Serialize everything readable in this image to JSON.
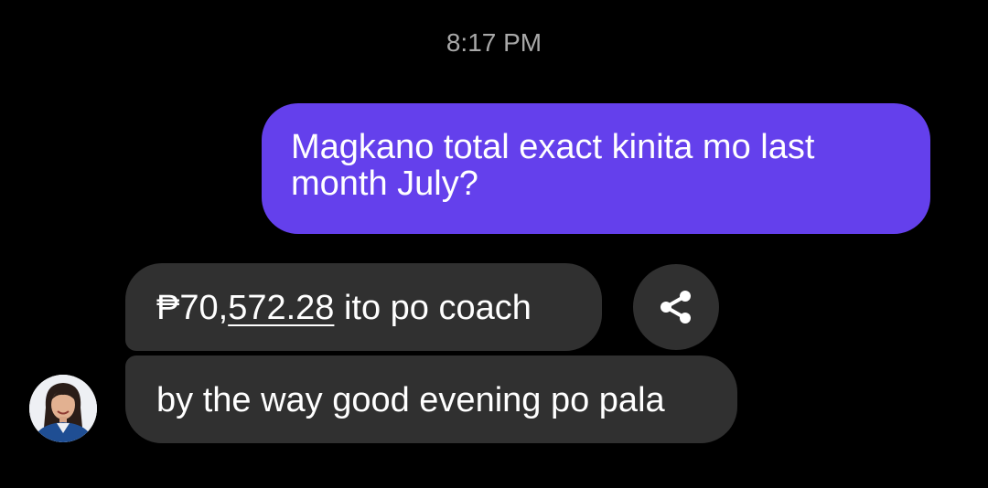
{
  "chat": {
    "timestamp": "8:17 PM",
    "messages": [
      {
        "direction": "outgoing",
        "text": "Magkano total exact kinita mo last month July?"
      },
      {
        "direction": "incoming",
        "currency_symbol": "₱",
        "amount_prefix": "70,",
        "amount_link": "572.28",
        "text_suffix": " ito po coach"
      },
      {
        "direction": "incoming",
        "text": "by the way good evening po pala"
      }
    ],
    "share_icon": "share-icon",
    "avatar_icon": "contact-avatar"
  },
  "colors": {
    "background": "#000000",
    "outgoing_bubble": "#6440ec",
    "incoming_bubble": "#303030",
    "timestamp_text": "#a8a8a8",
    "message_text": "#ffffff"
  }
}
